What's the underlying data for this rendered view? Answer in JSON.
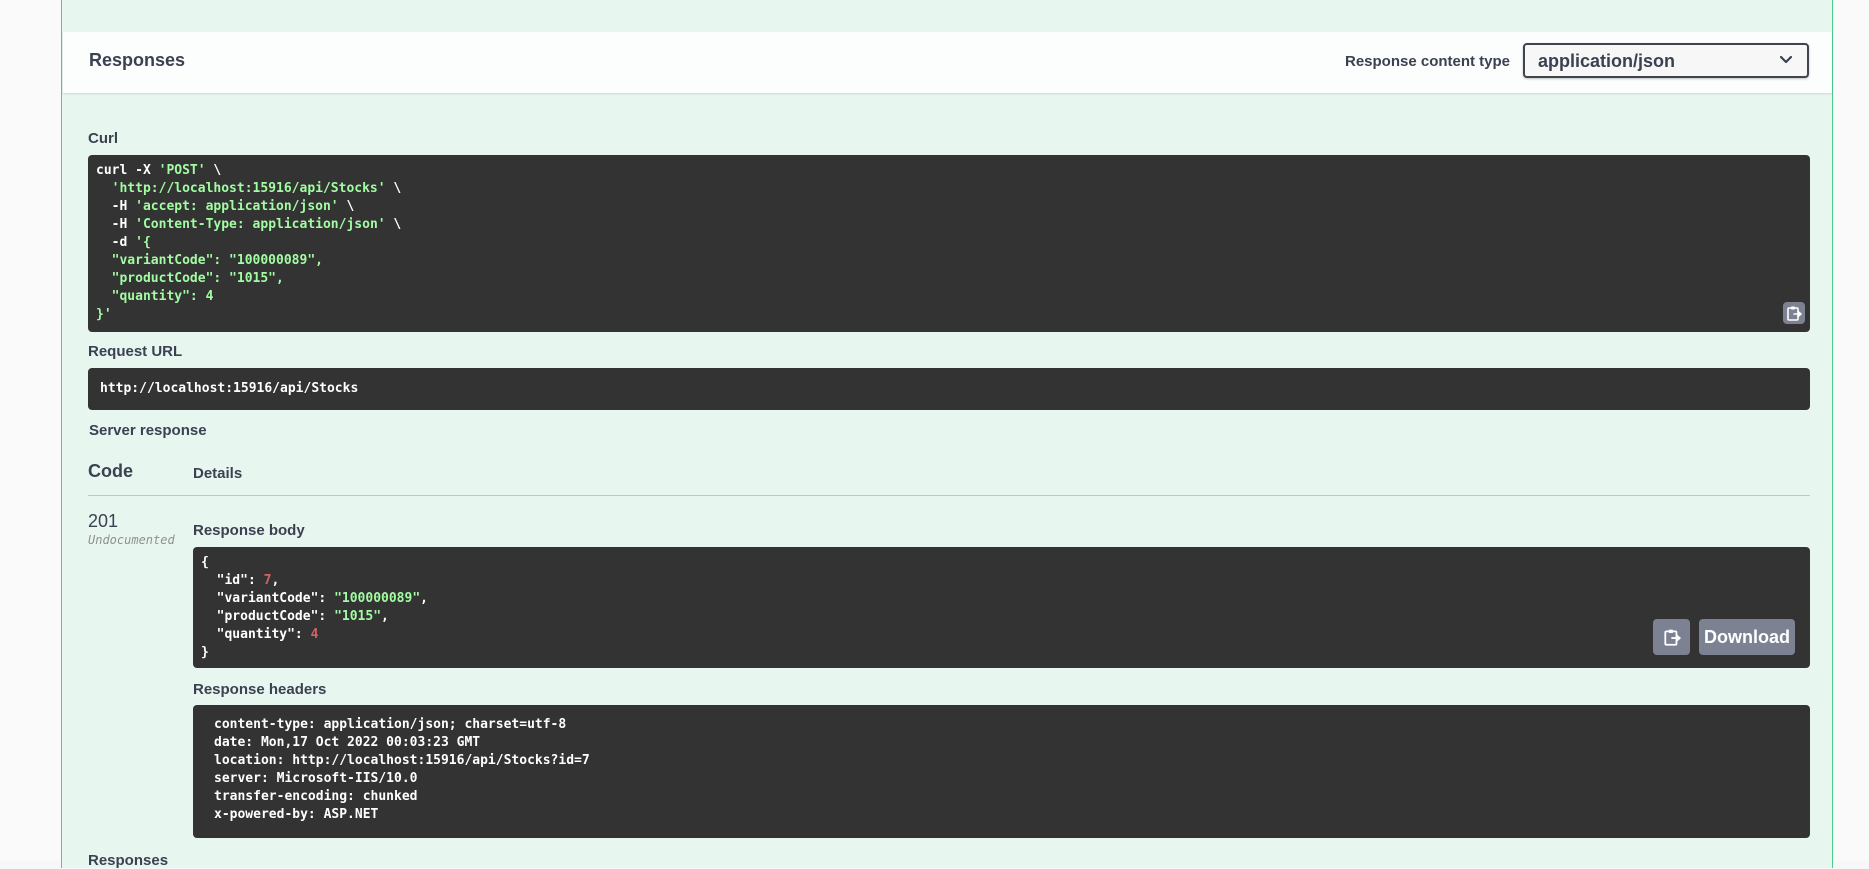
{
  "responses_header": {
    "title": "Responses",
    "content_type_label": "Response content type",
    "content_type_value": "application/json"
  },
  "curl": {
    "label": "Curl",
    "lines": [
      [
        {
          "t": "curl -X ",
          "c": "wht"
        },
        {
          "t": "'POST'",
          "c": "str"
        },
        {
          "t": " \\",
          "c": "wht"
        }
      ],
      [
        {
          "t": "  ",
          "c": "wht"
        },
        {
          "t": "'http://localhost:15916/api/Stocks'",
          "c": "str"
        },
        {
          "t": " \\",
          "c": "wht"
        }
      ],
      [
        {
          "t": "  -H ",
          "c": "wht"
        },
        {
          "t": "'accept: application/json'",
          "c": "str"
        },
        {
          "t": " \\",
          "c": "wht"
        }
      ],
      [
        {
          "t": "  -H ",
          "c": "wht"
        },
        {
          "t": "'Content-Type: application/json'",
          "c": "str"
        },
        {
          "t": " \\",
          "c": "wht"
        }
      ],
      [
        {
          "t": "  -d ",
          "c": "wht"
        },
        {
          "t": "'{",
          "c": "str"
        }
      ],
      [
        {
          "t": "  \"variantCode\": \"100000089\",",
          "c": "str"
        }
      ],
      [
        {
          "t": "  \"productCode\": \"1015\",",
          "c": "str"
        }
      ],
      [
        {
          "t": "  \"quantity\": 4",
          "c": "str"
        }
      ],
      [
        {
          "t": "}'",
          "c": "str"
        }
      ]
    ]
  },
  "request_url": {
    "label": "Request URL",
    "value": "http://localhost:15916/api/Stocks"
  },
  "server_response": {
    "label": "Server response",
    "col_code": "Code",
    "col_details": "Details",
    "status_code": "201",
    "status_note": "Undocumented",
    "body_label": "Response body",
    "body_lines": [
      [
        {
          "t": "{",
          "c": "wht"
        }
      ],
      [
        {
          "t": "  \"id\": ",
          "c": "wht"
        },
        {
          "t": "7",
          "c": "num"
        },
        {
          "t": ",",
          "c": "wht"
        }
      ],
      [
        {
          "t": "  \"variantCode\": ",
          "c": "wht"
        },
        {
          "t": "\"100000089\"",
          "c": "str"
        },
        {
          "t": ",",
          "c": "wht"
        }
      ],
      [
        {
          "t": "  \"productCode\": ",
          "c": "wht"
        },
        {
          "t": "\"1015\"",
          "c": "str"
        },
        {
          "t": ",",
          "c": "wht"
        }
      ],
      [
        {
          "t": "  \"quantity\": ",
          "c": "wht"
        },
        {
          "t": "4",
          "c": "num"
        }
      ],
      [
        {
          "t": "}",
          "c": "wht"
        }
      ]
    ],
    "download_label": "Download",
    "headers_label": "Response headers",
    "headers_lines": [
      "content-type: application/json; charset=utf-8",
      "date: Mon,17 Oct 2022 00:03:23 GMT",
      "location: http://localhost:15916/api/Stocks?id=7",
      "server: Microsoft-IIS/10.0",
      "transfer-encoding: chunked",
      "x-powered-by: ASP.NET"
    ]
  },
  "bottom": {
    "label": "Responses"
  },
  "icons": {
    "copy": "clipboard-copy-icon",
    "dropdown": "chevron-down-icon"
  },
  "colors": {
    "block_bg": "#e8f6f0",
    "block_border": "#49cc90",
    "code_bg": "#333333",
    "string": "#a2fca2",
    "number": "#d36363",
    "button": "#7d8293"
  }
}
